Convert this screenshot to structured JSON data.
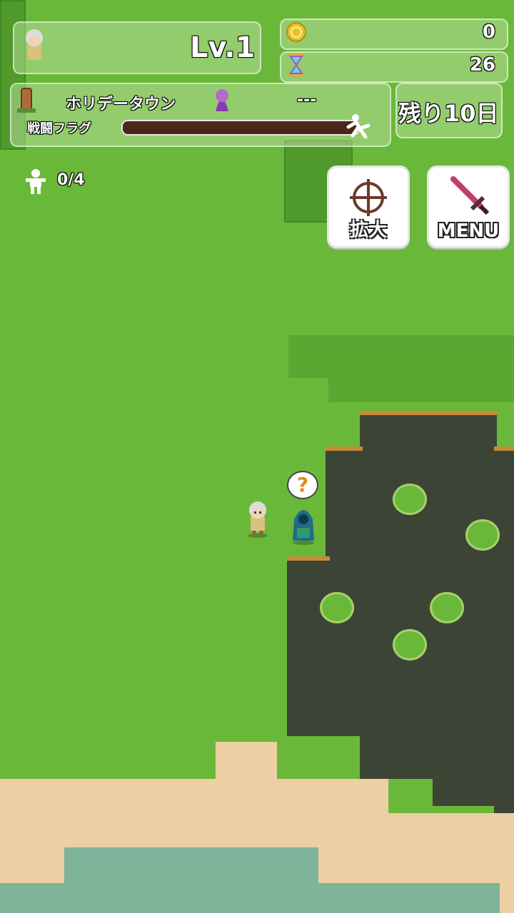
{
  "hud": {
    "level": "Lv.1",
    "gold": "0",
    "time": "26",
    "town": "ホリデータウン",
    "target": "---",
    "days_left": "残り10日",
    "battle_flag_label": "戦闘フラグ",
    "battle_flag_progress": 1.0,
    "party_count": "0/4"
  },
  "buttons": {
    "zoom_label": "拡大",
    "menu_label": "MENU"
  },
  "npc": {
    "bubble_symbol": "?"
  },
  "colors": {
    "grass": "#6ab83a",
    "swamp": "#3c4535",
    "sand": "#ecd0a4",
    "water": "#7fb39a",
    "flag_bar": "#4a2818"
  }
}
